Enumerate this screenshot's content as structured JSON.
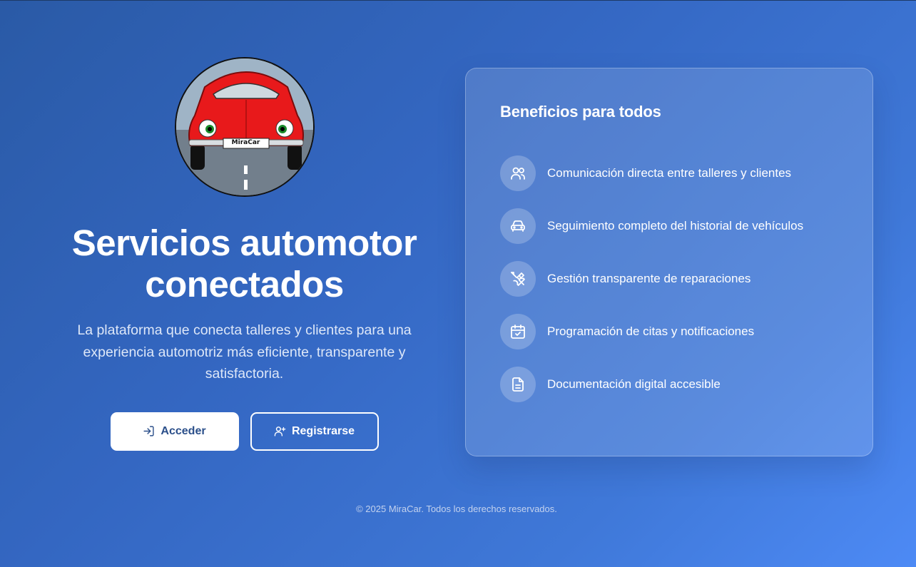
{
  "hero": {
    "logo_plate": "MiraCar",
    "title_line1": "Servicios automotor",
    "title_line2": "conectados",
    "subtitle": "La plataforma que conecta talleres y clientes para una experiencia automotriz más eficiente, transparente y satisfactoria.",
    "login_label": "Acceder",
    "register_label": "Registrarse"
  },
  "benefits": {
    "title": "Beneficios para todos",
    "items": [
      {
        "icon": "users-icon",
        "label": "Comunicación directa entre talleres y clientes"
      },
      {
        "icon": "car-icon",
        "label": "Seguimiento completo del historial de vehículos"
      },
      {
        "icon": "tools-icon",
        "label": "Gestión transparente de reparaciones"
      },
      {
        "icon": "calendar-check-icon",
        "label": "Programación de citas y notificaciones"
      },
      {
        "icon": "document-icon",
        "label": "Documentación digital accesible"
      }
    ]
  },
  "footer": {
    "copyright": "© 2025 MiraCar. Todos los derechos reservados."
  },
  "colors": {
    "background_start": "#2a5aa6",
    "background_end": "#4d8af5",
    "primary_button_text": "#2b4f8a",
    "car_red": "#e8191b"
  }
}
